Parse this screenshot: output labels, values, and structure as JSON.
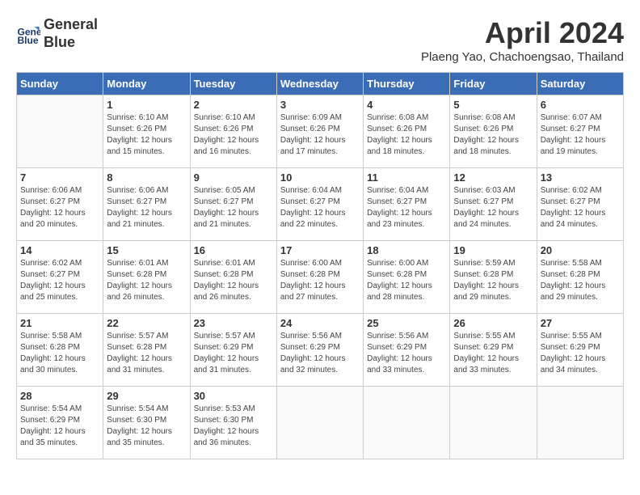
{
  "header": {
    "logo_line1": "General",
    "logo_line2": "Blue",
    "month_title": "April 2024",
    "location": "Plaeng Yao, Chachoengsao, Thailand"
  },
  "days_of_week": [
    "Sunday",
    "Monday",
    "Tuesday",
    "Wednesday",
    "Thursday",
    "Friday",
    "Saturday"
  ],
  "weeks": [
    [
      {
        "day": "",
        "info": ""
      },
      {
        "day": "1",
        "info": "Sunrise: 6:10 AM\nSunset: 6:26 PM\nDaylight: 12 hours\nand 15 minutes."
      },
      {
        "day": "2",
        "info": "Sunrise: 6:10 AM\nSunset: 6:26 PM\nDaylight: 12 hours\nand 16 minutes."
      },
      {
        "day": "3",
        "info": "Sunrise: 6:09 AM\nSunset: 6:26 PM\nDaylight: 12 hours\nand 17 minutes."
      },
      {
        "day": "4",
        "info": "Sunrise: 6:08 AM\nSunset: 6:26 PM\nDaylight: 12 hours\nand 18 minutes."
      },
      {
        "day": "5",
        "info": "Sunrise: 6:08 AM\nSunset: 6:26 PM\nDaylight: 12 hours\nand 18 minutes."
      },
      {
        "day": "6",
        "info": "Sunrise: 6:07 AM\nSunset: 6:27 PM\nDaylight: 12 hours\nand 19 minutes."
      }
    ],
    [
      {
        "day": "7",
        "info": "Sunrise: 6:06 AM\nSunset: 6:27 PM\nDaylight: 12 hours\nand 20 minutes."
      },
      {
        "day": "8",
        "info": "Sunrise: 6:06 AM\nSunset: 6:27 PM\nDaylight: 12 hours\nand 21 minutes."
      },
      {
        "day": "9",
        "info": "Sunrise: 6:05 AM\nSunset: 6:27 PM\nDaylight: 12 hours\nand 21 minutes."
      },
      {
        "day": "10",
        "info": "Sunrise: 6:04 AM\nSunset: 6:27 PM\nDaylight: 12 hours\nand 22 minutes."
      },
      {
        "day": "11",
        "info": "Sunrise: 6:04 AM\nSunset: 6:27 PM\nDaylight: 12 hours\nand 23 minutes."
      },
      {
        "day": "12",
        "info": "Sunrise: 6:03 AM\nSunset: 6:27 PM\nDaylight: 12 hours\nand 24 minutes."
      },
      {
        "day": "13",
        "info": "Sunrise: 6:02 AM\nSunset: 6:27 PM\nDaylight: 12 hours\nand 24 minutes."
      }
    ],
    [
      {
        "day": "14",
        "info": "Sunrise: 6:02 AM\nSunset: 6:27 PM\nDaylight: 12 hours\nand 25 minutes."
      },
      {
        "day": "15",
        "info": "Sunrise: 6:01 AM\nSunset: 6:28 PM\nDaylight: 12 hours\nand 26 minutes."
      },
      {
        "day": "16",
        "info": "Sunrise: 6:01 AM\nSunset: 6:28 PM\nDaylight: 12 hours\nand 26 minutes."
      },
      {
        "day": "17",
        "info": "Sunrise: 6:00 AM\nSunset: 6:28 PM\nDaylight: 12 hours\nand 27 minutes."
      },
      {
        "day": "18",
        "info": "Sunrise: 6:00 AM\nSunset: 6:28 PM\nDaylight: 12 hours\nand 28 minutes."
      },
      {
        "day": "19",
        "info": "Sunrise: 5:59 AM\nSunset: 6:28 PM\nDaylight: 12 hours\nand 29 minutes."
      },
      {
        "day": "20",
        "info": "Sunrise: 5:58 AM\nSunset: 6:28 PM\nDaylight: 12 hours\nand 29 minutes."
      }
    ],
    [
      {
        "day": "21",
        "info": "Sunrise: 5:58 AM\nSunset: 6:28 PM\nDaylight: 12 hours\nand 30 minutes."
      },
      {
        "day": "22",
        "info": "Sunrise: 5:57 AM\nSunset: 6:28 PM\nDaylight: 12 hours\nand 31 minutes."
      },
      {
        "day": "23",
        "info": "Sunrise: 5:57 AM\nSunset: 6:29 PM\nDaylight: 12 hours\nand 31 minutes."
      },
      {
        "day": "24",
        "info": "Sunrise: 5:56 AM\nSunset: 6:29 PM\nDaylight: 12 hours\nand 32 minutes."
      },
      {
        "day": "25",
        "info": "Sunrise: 5:56 AM\nSunset: 6:29 PM\nDaylight: 12 hours\nand 33 minutes."
      },
      {
        "day": "26",
        "info": "Sunrise: 5:55 AM\nSunset: 6:29 PM\nDaylight: 12 hours\nand 33 minutes."
      },
      {
        "day": "27",
        "info": "Sunrise: 5:55 AM\nSunset: 6:29 PM\nDaylight: 12 hours\nand 34 minutes."
      }
    ],
    [
      {
        "day": "28",
        "info": "Sunrise: 5:54 AM\nSunset: 6:29 PM\nDaylight: 12 hours\nand 35 minutes."
      },
      {
        "day": "29",
        "info": "Sunrise: 5:54 AM\nSunset: 6:30 PM\nDaylight: 12 hours\nand 35 minutes."
      },
      {
        "day": "30",
        "info": "Sunrise: 5:53 AM\nSunset: 6:30 PM\nDaylight: 12 hours\nand 36 minutes."
      },
      {
        "day": "",
        "info": ""
      },
      {
        "day": "",
        "info": ""
      },
      {
        "day": "",
        "info": ""
      },
      {
        "day": "",
        "info": ""
      }
    ]
  ]
}
